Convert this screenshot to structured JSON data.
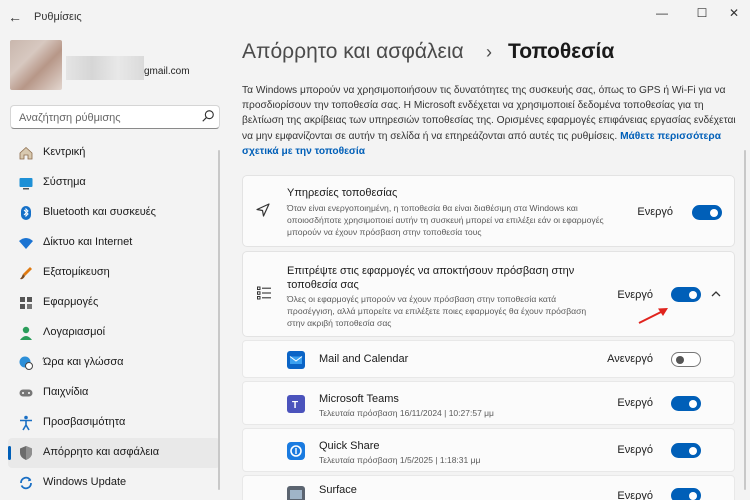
{
  "window": {
    "app_title": "Ρυθμίσεις",
    "back_icon": "back-arrow-icon"
  },
  "profile": {
    "email": "gmail.com"
  },
  "search": {
    "placeholder": "Αναζήτηση ρύθμισης"
  },
  "sidebar": {
    "items": [
      {
        "label": "Κεντρική",
        "icon": "home-icon"
      },
      {
        "label": "Σύστημα",
        "icon": "system-icon"
      },
      {
        "label": "Bluetooth και συσκευές",
        "icon": "bluetooth-icon"
      },
      {
        "label": "Δίκτυο και Internet",
        "icon": "wifi-icon"
      },
      {
        "label": "Εξατομίκευση",
        "icon": "brush-icon"
      },
      {
        "label": "Εφαρμογές",
        "icon": "apps-icon"
      },
      {
        "label": "Λογαριασμοί",
        "icon": "account-icon"
      },
      {
        "label": "Ώρα και γλώσσα",
        "icon": "globe-clock-icon"
      },
      {
        "label": "Παιχνίδια",
        "icon": "gamepad-icon"
      },
      {
        "label": "Προσβασιμότητα",
        "icon": "accessibility-icon"
      },
      {
        "label": "Απόρρητο και ασφάλεια",
        "icon": "shield-icon"
      },
      {
        "label": "Windows Update",
        "icon": "update-icon"
      }
    ],
    "active_index": 10
  },
  "breadcrumb": {
    "parent": "Απόρρητο και ασφάλεια",
    "separator": "›",
    "current": "Τοποθεσία"
  },
  "intro": {
    "text": "Τα Windows μπορούν να χρησιμοποιήσουν τις δυνατότητες της συσκευής σας, όπως το GPS ή Wi-Fi για να προσδιορίσουν την τοποθεσία σας. Η Microsoft ενδέχεται να χρησιμοποιεί δεδομένα τοποθεσίας για τη βελτίωση της ακρίβειας των υπηρεσιών τοποθεσίας της. Ορισμένες εφαρμογές επιφάνειας εργασίας ενδέχεται να μην εμφανίζονται σε αυτήν τη σελίδα ή να επηρεάζονται από αυτές τις ρυθμίσεις.",
    "link": "Μάθετε περισσότερα σχετικά με την τοποθεσία"
  },
  "location_services": {
    "title": "Υπηρεσίες τοποθεσίας",
    "description": "Όταν είναι ενεργοποιημένη, η τοποθεσία θα είναι διαθέσιμη στα Windows και οποιοσδήποτε χρησιμοποιεί αυτήν τη συσκευή μπορεί να επιλέξει εάν οι εφαρμογές μπορούν να έχουν πρόσβαση στην τοποθεσία τους",
    "status": "Ενεργό",
    "enabled": true
  },
  "app_access": {
    "title": "Επιτρέψτε στις εφαρμογές να αποκτήσουν πρόσβαση στην τοποθεσία σας",
    "description": "Όλες οι εφαρμογές μπορούν να έχουν πρόσβαση στην τοποθεσία κατά προσέγγιση, αλλά μπορείτε να επιλέξετε ποιες εφαρμογές θα έχουν πρόσβαση στην ακριβή τοποθεσία σας",
    "status": "Ενεργό",
    "enabled": true,
    "annotation_color": "#e0231d"
  },
  "apps": [
    {
      "name": "Mail and Calendar",
      "sub": "",
      "status": "Ανενεργό",
      "enabled": false,
      "icon": "mail-icon"
    },
    {
      "name": "Microsoft Teams",
      "sub": "Τελευταία πρόσβαση 16/11/2024 | 10:27:57 μμ",
      "status": "Ενεργό",
      "enabled": true,
      "icon": "teams-icon"
    },
    {
      "name": "Quick Share",
      "sub": "Τελευταία πρόσβαση 1/5/2025 | 1:18:31 μμ",
      "status": "Ενεργό",
      "enabled": true,
      "icon": "quick-share-icon"
    },
    {
      "name": "Surface",
      "sub": "",
      "status": "Ενεργό",
      "enabled": true,
      "icon": "surface-icon"
    }
  ],
  "colors": {
    "accent": "#005fb8"
  }
}
